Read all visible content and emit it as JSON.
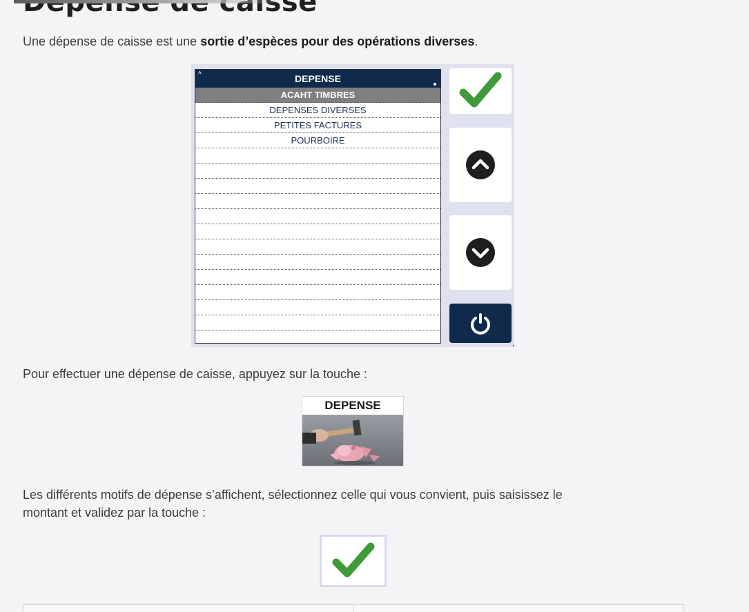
{
  "page": {
    "title": "Dépense de caisse",
    "intro_text": "Une dépense de caisse est une ",
    "intro_bold": "sortie d’espèces pour des opérations diverses",
    "intro_end": ".",
    "instruction_1": "Pour effectuer une dépense de caisse, appuyez sur la touche :",
    "instruction_2_line1": "Les différents motifs de dépense s’affichent, sélectionnez celle qui vous convient, puis saisissez le",
    "instruction_2_line2": "montant et validez par la touche :"
  },
  "pos_screen": {
    "list_header": "DEPENSE",
    "items": [
      {
        "label": "ACAHT TIMBRES",
        "selected": true
      },
      {
        "label": "DEPENSES DIVERSES",
        "selected": false
      },
      {
        "label": "PETITES FACTURES",
        "selected": false
      },
      {
        "label": "POURBOIRE",
        "selected": false
      },
      {
        "label": "",
        "selected": false
      },
      {
        "label": "",
        "selected": false
      },
      {
        "label": "",
        "selected": false
      },
      {
        "label": "",
        "selected": false
      },
      {
        "label": "",
        "selected": false
      },
      {
        "label": "",
        "selected": false
      },
      {
        "label": "",
        "selected": false
      },
      {
        "label": "",
        "selected": false
      },
      {
        "label": "",
        "selected": false
      },
      {
        "label": "",
        "selected": false
      },
      {
        "label": "",
        "selected": false
      },
      {
        "label": "",
        "selected": false
      }
    ],
    "buttons": [
      {
        "name": "validate-button",
        "icon": "checkmark-icon"
      },
      {
        "name": "scroll-up-button",
        "icon": "chevron-up-circle-icon"
      },
      {
        "name": "scroll-down-button",
        "icon": "chevron-down-circle-icon"
      },
      {
        "name": "power-button",
        "icon": "power-icon"
      }
    ]
  },
  "depense_key": {
    "label": "DEPENSE",
    "image": "piggy-bank-hammer-image"
  },
  "validate_key": {
    "icon": "checkmark-icon"
  },
  "colors": {
    "navy": "#0f2a4a",
    "check_green": "#3f9b3a",
    "selected_row": "#7f7f7f",
    "screen_bg": "#dfe1ef",
    "page_bg": "#f4f4f6"
  }
}
